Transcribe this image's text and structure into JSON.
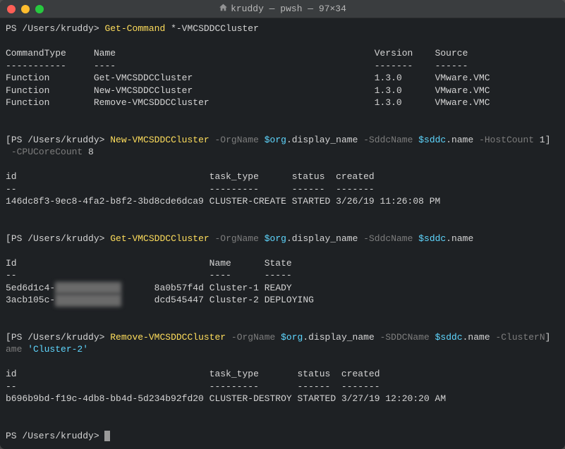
{
  "window": {
    "title": "kruddy — pwsh — 97×34"
  },
  "commands": {
    "c1": {
      "prompt": "PS /Users/kruddy>",
      "cmd": "Get-Command",
      "args": "*-VMCSDDCCluster"
    },
    "c1_headers": {
      "col1": "CommandType",
      "col2": "Name",
      "col3": "Version",
      "col4": "Source"
    },
    "c1_dashes": {
      "d1": "-----------",
      "d2": "----",
      "d3": "-------",
      "d4": "------"
    },
    "c1_rows": [
      {
        "t": "Function",
        "n": "Get-VMCSDDCCluster",
        "v": "1.3.0",
        "s": "VMware.VMC"
      },
      {
        "t": "Function",
        "n": "New-VMCSDDCCluster",
        "v": "1.3.0",
        "s": "VMware.VMC"
      },
      {
        "t": "Function",
        "n": "Remove-VMCSDDCCluster",
        "v": "1.3.0",
        "s": "VMware.VMC"
      }
    ],
    "c2": {
      "prompt": "PS /Users/kruddy>",
      "cmd": "New-VMCSDDCCluster",
      "p1": "-OrgName",
      "v1a": "$org",
      "v1b": ".display_name",
      "p2": "-SddcName",
      "v2a": "$sddc",
      "v2b": ".name",
      "p3": "-HostCount",
      "n3": "1",
      "p4": "-CPUCoreCount",
      "n4": "8"
    },
    "c2_headers": {
      "col1": "id",
      "col2": "task_type",
      "col3": "status",
      "col4": "created"
    },
    "c2_dashes": {
      "d1": "--",
      "d2": "---------",
      "d3": "------",
      "d4": "-------"
    },
    "c2_row": {
      "id": "146dc8f3-9ec8-4fa2-b8f2-3bd8cde6dca9",
      "task": "CLUSTER-CREATE",
      "status": "STARTED",
      "created": "3/26/19 11:26:08 PM"
    },
    "c3": {
      "prompt": "PS /Users/kruddy>",
      "cmd": "Get-VMCSDDCCluster",
      "p1": "-OrgName",
      "v1a": "$org",
      "v1b": ".display_name",
      "p2": "-SddcName",
      "v2a": "$sddc",
      "v2b": ".name"
    },
    "c3_headers": {
      "col1": "Id",
      "col2": "Name",
      "col3": "State"
    },
    "c3_dashes": {
      "d1": "--",
      "d2": "----",
      "d3": "-----"
    },
    "c3_rows": [
      {
        "id_a": "5ed6d1c4-",
        "id_redact": "xxxxxxxxxxxx",
        "id_b": "8a0b57f4d",
        "name": "Cluster-1",
        "state": "READY"
      },
      {
        "id_a": "3acb105c-",
        "id_redact": "xxxxxxxxxxxx",
        "id_b": "dcd545447",
        "name": "Cluster-2",
        "state": "DEPLOYING"
      }
    ],
    "c4": {
      "prompt": "PS /Users/kruddy>",
      "cmd": "Remove-VMCSDDCCluster",
      "p1": "-OrgName",
      "v1a": "$org",
      "v1b": ".display_name",
      "p2": "-SDDCName",
      "v2a": "$sddc",
      "v2b": ".name",
      "p3": "-ClusterN",
      "p3b": "ame",
      "s": "'Cluster-2'"
    },
    "c4_headers": {
      "col1": "id",
      "col2": "task_type",
      "col3": "status",
      "col4": "created"
    },
    "c4_dashes": {
      "d1": "--",
      "d2": "---------",
      "d3": "------",
      "d4": "-------"
    },
    "c4_row": {
      "id": "b696b9bd-f19c-4db8-bb4d-5d234b92fd20",
      "task": "CLUSTER-DESTROY",
      "status": "STARTED",
      "created": "3/27/19 12:20:20 AM"
    },
    "c5": {
      "prompt": "PS /Users/kruddy>"
    }
  }
}
